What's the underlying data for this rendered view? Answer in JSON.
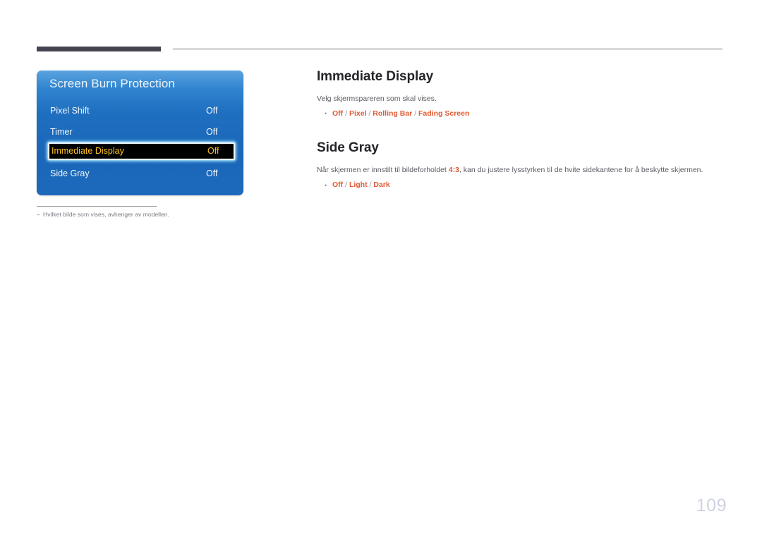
{
  "osd": {
    "title": "Screen Burn Protection",
    "rows": [
      {
        "label": "Pixel Shift",
        "value": "Off",
        "selected": false
      },
      {
        "label": "Timer",
        "value": "Off",
        "selected": false
      },
      {
        "label": "Immediate Display",
        "value": "Off",
        "selected": true
      },
      {
        "label": "Side Gray",
        "value": "Off",
        "selected": false
      }
    ],
    "footnote_dash": "‒",
    "footnote": "Hvilket bilde som vises, avhenger av modellen."
  },
  "sections": [
    {
      "heading": "Immediate Display",
      "description": "Velg skjermspareren som skal vises.",
      "bullet_dot": "•",
      "options": [
        "Off",
        "Pixel",
        "Rolling Bar",
        "Fading Screen"
      ]
    },
    {
      "heading": "Side Gray",
      "description_pre": "Når skjermen er innstilt til bildeforholdet ",
      "description_highlight": "4:3",
      "description_post": ", kan du justere lysstyrken til de hvite sidekantene for å beskytte skjermen.",
      "bullet_dot": "•",
      "options": [
        "Off",
        "Light",
        "Dark"
      ]
    }
  ],
  "separator": "/",
  "page_number": "109",
  "colors": {
    "accent_option": "#e15a34",
    "osd_panel_blue": "#1f6fc0",
    "osd_selected_text": "#ffc324",
    "heading": "#262329",
    "page_number": "#cfd2e4",
    "top_rule": "#46424f"
  }
}
